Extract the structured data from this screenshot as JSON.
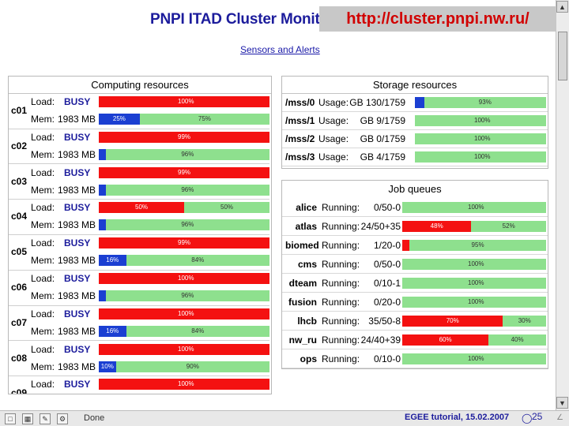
{
  "page": {
    "title": "PNPI ITAD Cluster Monito",
    "url_overlay": "http://cluster.pnpi.nw.ru/",
    "sensors_link": "Sensors and Alerts"
  },
  "computing": {
    "header": "Computing resources",
    "load_label": "Load:",
    "mem_label": "Mem:",
    "nodes": [
      {
        "name": "c01",
        "status": "BUSY",
        "mem": "1983 MB",
        "load": [
          {
            "color": "red",
            "pct": 100,
            "label": "100%"
          }
        ],
        "memory": [
          {
            "color": "blue",
            "pct": 24,
            "label": "25%"
          },
          {
            "color": "green",
            "pct": 76,
            "label": "75%"
          }
        ]
      },
      {
        "name": "c02",
        "status": "BUSY",
        "mem": "1983 MB",
        "load": [
          {
            "color": "red",
            "pct": 100,
            "label": "99%"
          }
        ],
        "memory": [
          {
            "color": "blue",
            "pct": 4,
            "label": ""
          },
          {
            "color": "green",
            "pct": 96,
            "label": "96%"
          }
        ]
      },
      {
        "name": "c03",
        "status": "BUSY",
        "mem": "1983 MB",
        "load": [
          {
            "color": "red",
            "pct": 100,
            "label": "99%"
          }
        ],
        "memory": [
          {
            "color": "blue",
            "pct": 4,
            "label": ""
          },
          {
            "color": "green",
            "pct": 96,
            "label": "96%"
          }
        ]
      },
      {
        "name": "c04",
        "status": "BUSY",
        "mem": "1983 MB",
        "load": [
          {
            "color": "red",
            "pct": 50,
            "label": "50%"
          },
          {
            "color": "green",
            "pct": 50,
            "label": "50%"
          }
        ],
        "memory": [
          {
            "color": "blue",
            "pct": 4,
            "label": ""
          },
          {
            "color": "green",
            "pct": 96,
            "label": "96%"
          }
        ]
      },
      {
        "name": "c05",
        "status": "BUSY",
        "mem": "1983 MB",
        "load": [
          {
            "color": "red",
            "pct": 100,
            "label": "99%"
          }
        ],
        "memory": [
          {
            "color": "blue",
            "pct": 16,
            "label": "16%"
          },
          {
            "color": "green",
            "pct": 84,
            "label": "84%"
          }
        ]
      },
      {
        "name": "c06",
        "status": "BUSY",
        "mem": "1983 MB",
        "load": [
          {
            "color": "red",
            "pct": 100,
            "label": "100%"
          }
        ],
        "memory": [
          {
            "color": "blue",
            "pct": 4,
            "label": ""
          },
          {
            "color": "green",
            "pct": 96,
            "label": "96%"
          }
        ]
      },
      {
        "name": "c07",
        "status": "BUSY",
        "mem": "1983 MB",
        "load": [
          {
            "color": "red",
            "pct": 100,
            "label": "100%"
          }
        ],
        "memory": [
          {
            "color": "blue",
            "pct": 16,
            "label": "16%"
          },
          {
            "color": "green",
            "pct": 84,
            "label": "84%"
          }
        ]
      },
      {
        "name": "c08",
        "status": "BUSY",
        "mem": "1983 MB",
        "load": [
          {
            "color": "red",
            "pct": 100,
            "label": "100%"
          }
        ],
        "memory": [
          {
            "color": "blue",
            "pct": 10,
            "label": "10%"
          },
          {
            "color": "green",
            "pct": 90,
            "label": "90%"
          }
        ]
      },
      {
        "name": "c09",
        "status": "BUSY",
        "mem": "",
        "load": [
          {
            "color": "red",
            "pct": 100,
            "label": "100%"
          }
        ],
        "memory": []
      }
    ]
  },
  "storage": {
    "header": "Storage resources",
    "usage_label": "Usage:",
    "items": [
      {
        "name": "/mss/0",
        "usage": "130/1759 GB",
        "bar": [
          {
            "color": "blue",
            "pct": 7,
            "label": ""
          },
          {
            "color": "green",
            "pct": 93,
            "label": "93%"
          }
        ]
      },
      {
        "name": "/mss/1",
        "usage": "9/1759 GB",
        "bar": [
          {
            "color": "green",
            "pct": 100,
            "label": "100%"
          }
        ]
      },
      {
        "name": "/mss/2",
        "usage": "0/1759 GB",
        "bar": [
          {
            "color": "green",
            "pct": 100,
            "label": "100%"
          }
        ]
      },
      {
        "name": "/mss/3",
        "usage": "4/1759 GB",
        "bar": [
          {
            "color": "green",
            "pct": 100,
            "label": "100%"
          }
        ]
      }
    ]
  },
  "queues": {
    "header": "Job queues",
    "running_label": "Running:",
    "items": [
      {
        "name": "alice",
        "running": "0/50-0",
        "bar": [
          {
            "color": "green",
            "pct": 100,
            "label": "100%"
          }
        ]
      },
      {
        "name": "atlas",
        "running": "24/50+35",
        "bar": [
          {
            "color": "red",
            "pct": 48,
            "label": "48%"
          },
          {
            "color": "green",
            "pct": 52,
            "label": "52%"
          }
        ]
      },
      {
        "name": "biomed",
        "running": "1/20-0",
        "bar": [
          {
            "color": "red",
            "pct": 5,
            "label": ""
          },
          {
            "color": "green",
            "pct": 95,
            "label": "95%"
          }
        ]
      },
      {
        "name": "cms",
        "running": "0/50-0",
        "bar": [
          {
            "color": "green",
            "pct": 100,
            "label": "100%"
          }
        ]
      },
      {
        "name": "dteam",
        "running": "0/10-1",
        "bar": [
          {
            "color": "green",
            "pct": 100,
            "label": "100%"
          }
        ]
      },
      {
        "name": "fusion",
        "running": "0/20-0",
        "bar": [
          {
            "color": "green",
            "pct": 100,
            "label": "100%"
          }
        ]
      },
      {
        "name": "lhcb",
        "running": "35/50-8",
        "bar": [
          {
            "color": "red",
            "pct": 70,
            "label": "70%"
          },
          {
            "color": "green",
            "pct": 30,
            "label": "30%"
          }
        ]
      },
      {
        "name": "nw_ru",
        "running": "24/40+39",
        "bar": [
          {
            "color": "red",
            "pct": 60,
            "label": "60%"
          },
          {
            "color": "green",
            "pct": 40,
            "label": "40%"
          }
        ]
      },
      {
        "name": "ops",
        "running": "0/10-0",
        "bar": [
          {
            "color": "green",
            "pct": 100,
            "label": "100%"
          }
        ]
      }
    ]
  },
  "status_bar": {
    "status_text": "Done",
    "footer": "EGEE tutorial, 15.02.2007",
    "slide_number": "25"
  },
  "colors": {
    "busy": "#f41111",
    "free": "#8ee08e",
    "used": "#1b3fd2",
    "title": "#1c1c9c",
    "url": "#d10000"
  },
  "icons": [
    "page-icon",
    "table-icon",
    "edit-icon",
    "settings-icon",
    "globe-icon",
    "resize-grip-icon"
  ]
}
